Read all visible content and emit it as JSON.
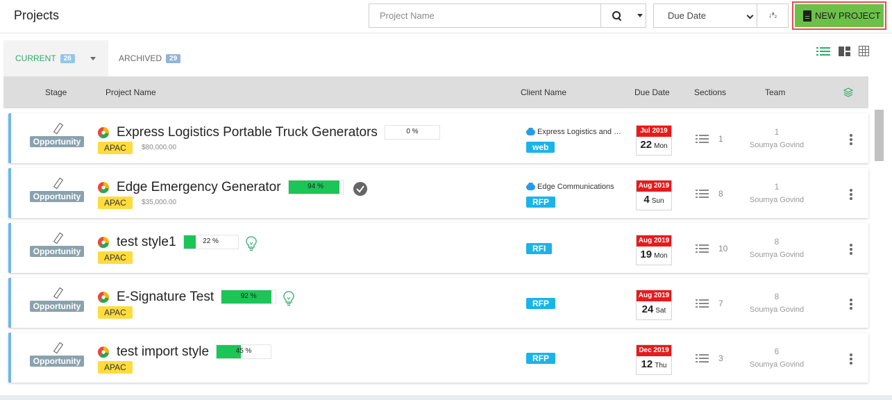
{
  "header": {
    "title": "Projects",
    "search_placeholder": "Project Name",
    "sort_value": "Due Date",
    "sort_dir_glyph": "↓ª₂",
    "new_project_label": "NEW PROJECT"
  },
  "tabs": {
    "current": {
      "label": "CURRENT",
      "count": "26"
    },
    "archived": {
      "label": "ARCHIVED",
      "count": "29"
    }
  },
  "columns": {
    "stage": "Stage",
    "project_name": "Project Name",
    "client_name": "Client Name",
    "due_date": "Due Date",
    "sections": "Sections",
    "team": "Team"
  },
  "colors": {
    "accent_green": "#2eaa6a",
    "button_green": "#6cc04a",
    "progress_green": "#1bc557",
    "region_yellow": "#fedc3d",
    "type_blue": "#1bb4e8",
    "date_red": "#e81a1a",
    "row_border": "#6db8ea"
  },
  "projects": [
    {
      "stage": "Opportunity",
      "name": "Express Logistics Portable Truck Generators",
      "progress": 0,
      "progress_label": "0 %",
      "region": "APAC",
      "amount": "$80,000.00",
      "client": "Express Logistics and …",
      "type": "web",
      "due_month": "Jul 2019",
      "due_day": "22",
      "due_weekday": "Mon",
      "sections": "1",
      "team_count": "1",
      "team_member": "Soumya Govind",
      "status_icon": "none"
    },
    {
      "stage": "Opportunity",
      "name": "Edge Emergency Generator",
      "progress": 94,
      "progress_label": "94 %",
      "region": "APAC",
      "amount": "$35,000.00",
      "client": "Edge Communications",
      "type": "RFP",
      "due_month": "Aug 2019",
      "due_day": "4",
      "due_weekday": "Sun",
      "sections": "8",
      "team_count": "1",
      "team_member": "Soumya Govind",
      "status_icon": "check-circle-icon"
    },
    {
      "stage": "Opportunity",
      "name": "test style1",
      "progress": 22,
      "progress_label": "22 %",
      "region": "APAC",
      "amount": "",
      "client": "",
      "type": "RFI",
      "due_month": "Aug 2019",
      "due_day": "19",
      "due_weekday": "Mon",
      "sections": "10",
      "team_count": "8",
      "team_member": "Soumya Govind",
      "status_icon": "lightbulb-icon"
    },
    {
      "stage": "Opportunity",
      "name": "E-Signature Test",
      "progress": 92,
      "progress_label": "92 %",
      "region": "APAC",
      "amount": "",
      "client": "",
      "type": "RFP",
      "due_month": "Aug 2019",
      "due_day": "24",
      "due_weekday": "Sat",
      "sections": "7",
      "team_count": "8",
      "team_member": "Soumya Govind",
      "status_icon": "lightbulb-icon"
    },
    {
      "stage": "Opportunity",
      "name": "test import style",
      "progress": 45,
      "progress_label": "45 %",
      "region": "APAC",
      "amount": "",
      "client": "",
      "type": "RFP",
      "due_month": "Dec 2019",
      "due_day": "12",
      "due_weekday": "Thu",
      "sections": "3",
      "team_count": "6",
      "team_member": "Soumya Govind",
      "status_icon": "none"
    }
  ]
}
